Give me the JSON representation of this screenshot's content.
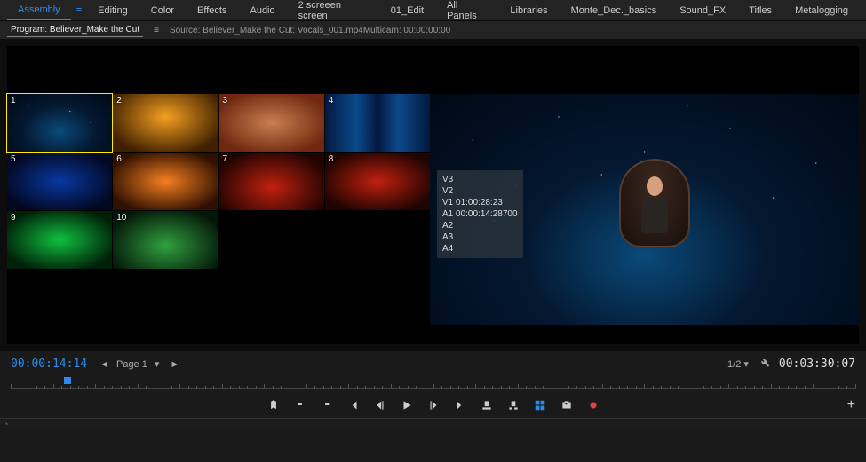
{
  "workspaces": {
    "items": [
      "Assembly",
      "Editing",
      "Color",
      "Effects",
      "Audio",
      "2 screeen screen",
      "01_Edit",
      "All Panels",
      "Libraries",
      "Monte_Dec._basics",
      "Sound_FX",
      "Titles",
      "Metalogging"
    ],
    "active_index": 0
  },
  "panel": {
    "tab_label": "Program: Believer_Make the Cut",
    "source_label": "Source: Believer_Make the Cut: Vocals_001.mp4Multicam: 00:00:00:00"
  },
  "cameras": [
    {
      "num": "1",
      "bg": "bg-blue-stars",
      "selected": true
    },
    {
      "num": "2",
      "bg": "bg-orange-person",
      "selected": false
    },
    {
      "num": "3",
      "bg": "bg-face",
      "selected": false
    },
    {
      "num": "4",
      "bg": "bg-blue-two",
      "selected": false
    },
    {
      "num": "5",
      "bg": "bg-blue-silhouette",
      "selected": false
    },
    {
      "num": "6",
      "bg": "bg-orange-drums",
      "selected": false
    },
    {
      "num": "7",
      "bg": "bg-red-wide",
      "selected": false
    },
    {
      "num": "8",
      "bg": "bg-red-drums",
      "selected": false
    },
    {
      "num": "9",
      "bg": "bg-green-dance",
      "selected": false
    },
    {
      "num": "10",
      "bg": "bg-green-mist",
      "selected": false
    }
  ],
  "overlay": {
    "lines": [
      "V3",
      "V2",
      "V1 01:00:28:23",
      "A1 00:00:14:28700",
      "A2",
      "A3",
      "A4"
    ]
  },
  "timecode": {
    "current": "00:00:14:14",
    "page_label": "Page 1",
    "zoom": "1/2",
    "duration": "00:03:30:07"
  },
  "transport": {
    "buttons": [
      "marker",
      "in",
      "out",
      "goto-in",
      "step-back",
      "play",
      "step-forward",
      "goto-out",
      "lift",
      "extract",
      "multicam-toggle",
      "export-frame",
      "record"
    ]
  }
}
